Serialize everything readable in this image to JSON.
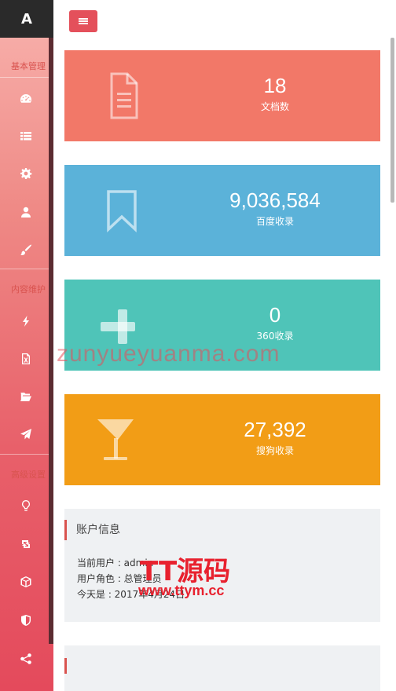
{
  "brand": {
    "logo": "A"
  },
  "sidebar": {
    "sections": [
      {
        "title": "基本管理",
        "icons": [
          "dashboard-icon",
          "list-icon",
          "gear-icon",
          "user-icon",
          "brush-icon"
        ]
      },
      {
        "title": "内容维护",
        "icons": [
          "bolt-icon",
          "excel-file-icon",
          "folder-open-icon",
          "paper-plane-icon"
        ]
      },
      {
        "title": "高级设置",
        "icons": [
          "lightbulb-icon",
          "retweet-icon",
          "cube-icon",
          "shield-icon",
          "share-icon"
        ]
      }
    ]
  },
  "stats": [
    {
      "value": "18",
      "label": "文档数",
      "color": "#f27868",
      "icon": "document-icon"
    },
    {
      "value": "9,036,584",
      "label": "百度收录",
      "color": "#5bb2d9",
      "icon": "bookmark-icon"
    },
    {
      "value": "0",
      "label": "360收录",
      "color": "#4fc4b8",
      "icon": "plus-icon"
    },
    {
      "value": "27,392",
      "label": "搜狗收录",
      "color": "#f29d16",
      "icon": "cocktail-icon"
    }
  ],
  "account_panel": {
    "title": "账户信息",
    "current_user": "当前用户 : admin",
    "user_role": "用户角色 : 总管理员",
    "today": "今天是 : 2017年4月24日"
  },
  "watermarks": {
    "text1": "zunyueyuanma.com",
    "text2": "TT源码",
    "text3": "www.ttym.cc"
  }
}
